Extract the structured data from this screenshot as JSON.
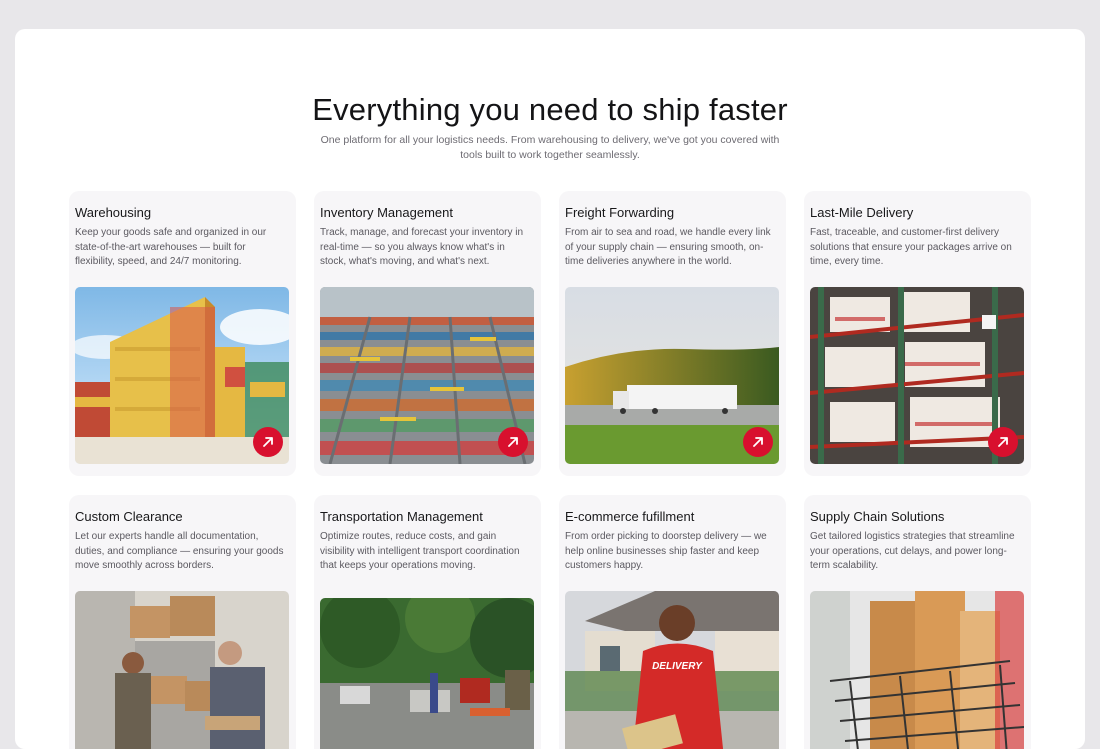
{
  "header": {
    "title": "Everything you need to ship faster",
    "subtitle": "One platform for all your logistics needs. From warehousing to delivery, we've got you covered with tools built to work together seamlessly."
  },
  "colors": {
    "page_background": "#e8e7ea",
    "card_background": "#f7f6f8",
    "accent": "#d8102e"
  },
  "services": [
    {
      "title": "Warehousing",
      "description": "Keep your goods safe and organized in our state-of-the-art warehouses — built for flexibility, speed, and 24/7 monitoring.",
      "image": "shipping-containers-photo",
      "icon": "arrow-up-right-icon"
    },
    {
      "title": "Inventory Management",
      "description": "Track, manage, and forecast your inventory in real-time — so you always know what's in stock, what's moving, and what's next.",
      "image": "container-port-aerial-photo",
      "icon": "arrow-up-right-icon"
    },
    {
      "title": "Freight Forwarding",
      "description": "From air to sea and road, we handle every link of your supply chain — ensuring smooth, on-time deliveries anywhere in the world.",
      "image": "truck-on-road-photo",
      "icon": "arrow-up-right-icon"
    },
    {
      "title": "Last-Mile Delivery",
      "description": "Fast, traceable, and customer-first delivery solutions that ensure your packages arrive on time, every time.",
      "image": "warehouse-shelves-photo",
      "icon": "arrow-up-right-icon"
    },
    {
      "title": "Custom Clearance",
      "description": "Let our experts handle all documentation, duties, and compliance — ensuring your goods move smoothly across borders.",
      "image": "workers-with-boxes-photo",
      "icon": "arrow-up-right-icon"
    },
    {
      "title": "Transportation Management",
      "description": "Optimize routes, reduce costs, and gain visibility with intelligent transport coordination that keeps your operations moving.",
      "image": "street-traffic-photo",
      "icon": "arrow-up-right-icon"
    },
    {
      "title": "E-commerce fufillment",
      "description": "From order picking to doorstep delivery — we help online businesses ship faster and keep customers happy.",
      "image": "delivery-person-photo",
      "delivery_shirt_text": "DELIVERY",
      "icon": "arrow-up-right-icon"
    },
    {
      "title": "Supply Chain Solutions",
      "description": "Get tailored logistics strategies that streamline your operations, cut delays, and power long-term scalability.",
      "image": "parcels-in-basket-photo",
      "icon": "arrow-up-right-icon"
    }
  ]
}
